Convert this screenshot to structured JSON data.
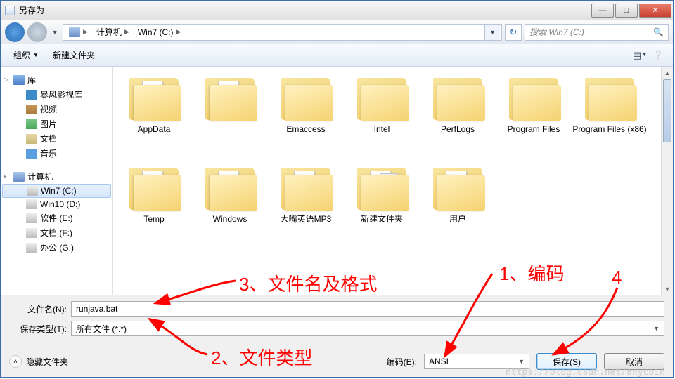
{
  "window": {
    "title": "另存为"
  },
  "breadcrumb": {
    "root_icon": "computer",
    "seg1": "计算机",
    "seg2": "Win7 (C:)"
  },
  "search": {
    "placeholder": "搜索 Win7 (C:)"
  },
  "toolbar": {
    "organize": "组织",
    "new_folder": "新建文件夹"
  },
  "sidebar": {
    "libraries_label": "库",
    "libraries_children": [
      "暴风影视库",
      "视频",
      "图片",
      "文档",
      "音乐"
    ],
    "computer_label": "计算机",
    "drives": [
      {
        "label": "Win7 (C:)",
        "selected": true
      },
      {
        "label": "Win10 (D:)"
      },
      {
        "label": "软件 (E:)"
      },
      {
        "label": "文档 (F:)"
      },
      {
        "label": "办公 (G:)"
      }
    ]
  },
  "files": [
    {
      "name": "AppData",
      "paper": true
    },
    {
      "name": "",
      "paper": true,
      "bat": true
    },
    {
      "name": "Emaccess"
    },
    {
      "name": "Intel"
    },
    {
      "name": "PerfLogs"
    },
    {
      "name": "Program Files"
    },
    {
      "name": "Program Files (x86)"
    },
    {
      "name": "Temp",
      "paper": true
    },
    {
      "name": "Windows",
      "paper": true,
      "bat": true
    },
    {
      "name": "大嘴英语MP3",
      "paper": true
    },
    {
      "name": "新建文件夹",
      "paper2": true
    },
    {
      "name": "用户",
      "paper": true
    }
  ],
  "form": {
    "filename_label": "文件名(N):",
    "filename_value": "runjava.bat",
    "filetype_label": "保存类型(T):",
    "filetype_value": "所有文件 (*.*)",
    "hide_folders": "隐藏文件夹",
    "encoding_label": "编码(E):",
    "encoding_value": "ANSI",
    "save_button": "保存(S)",
    "cancel_button": "取消"
  },
  "annotations": {
    "a1": "1、编码",
    "a2": "2、文件类型",
    "a3": "3、文件名及格式",
    "a4": "4"
  },
  "watermark": "https://blog.csdn.net/anycoin"
}
